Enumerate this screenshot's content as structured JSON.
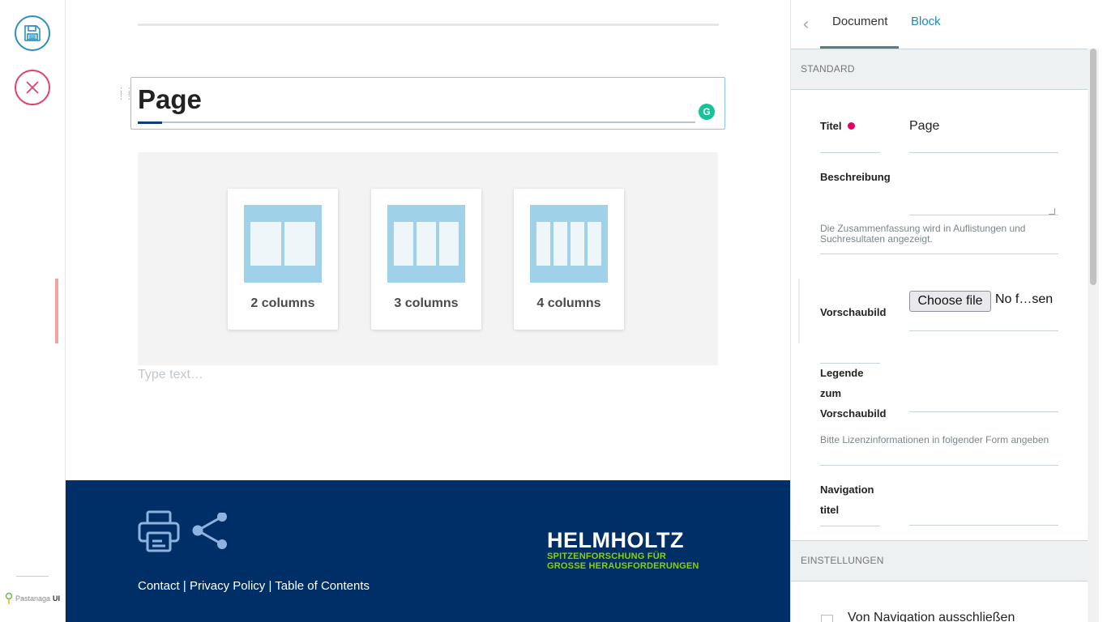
{
  "toolbar": {
    "brand_name": "Pastanaga",
    "brand_suffix": "UI",
    "save_icon": "save-icon",
    "cancel_icon": "close-icon"
  },
  "editor": {
    "title": "Page",
    "grammarly_letter": "G",
    "grid_options": [
      {
        "label": "2 columns",
        "cols": 2
      },
      {
        "label": "3 columns",
        "cols": 3
      },
      {
        "label": "4 columns",
        "cols": 4
      }
    ],
    "text_placeholder": "Type text…"
  },
  "footer": {
    "link_contact": "Contact",
    "link_privacy": "Privacy Policy",
    "link_toc": "Table of Contents",
    "separator": " | ",
    "logo_name": "HELMHOLTZ",
    "logo_tag_1": "SPITZENFORSCHUNG FÜR",
    "logo_tag_2": "GROSSE HERAUSFORDERUNGEN"
  },
  "sidebar": {
    "tabs": {
      "document": "Document",
      "block": "Block"
    },
    "section_standard": "STANDARD",
    "section_settings": "EINSTELLUNGEN",
    "fields": {
      "title_label": "Titel",
      "title_value": "Page",
      "description_label": "Beschreibung",
      "description_help": "Die Zusammenfassung wird in Auflistungen und Suchresultaten angezeigt.",
      "preview_label": "Vorschaubild",
      "file_button": "Choose file",
      "file_name": "No f…sen",
      "caption_label_1": "Legende",
      "caption_label_2": "zum",
      "caption_label_3": "Vorschaubild",
      "caption_help": "Bitte Lizenzinformationen in folgender Form angeben",
      "navtitle_label_1": "Navigation",
      "navtitle_label_2": "titel",
      "exclude_nav_label": "Von Navigation ausschließen"
    }
  },
  "colors": {
    "accent_blue": "#1c8bc0",
    "cancel_pink": "#e0416b",
    "footer_navy": "#002f67",
    "helmholtz_green": "#8cd000",
    "required_dot": "#e40166"
  }
}
